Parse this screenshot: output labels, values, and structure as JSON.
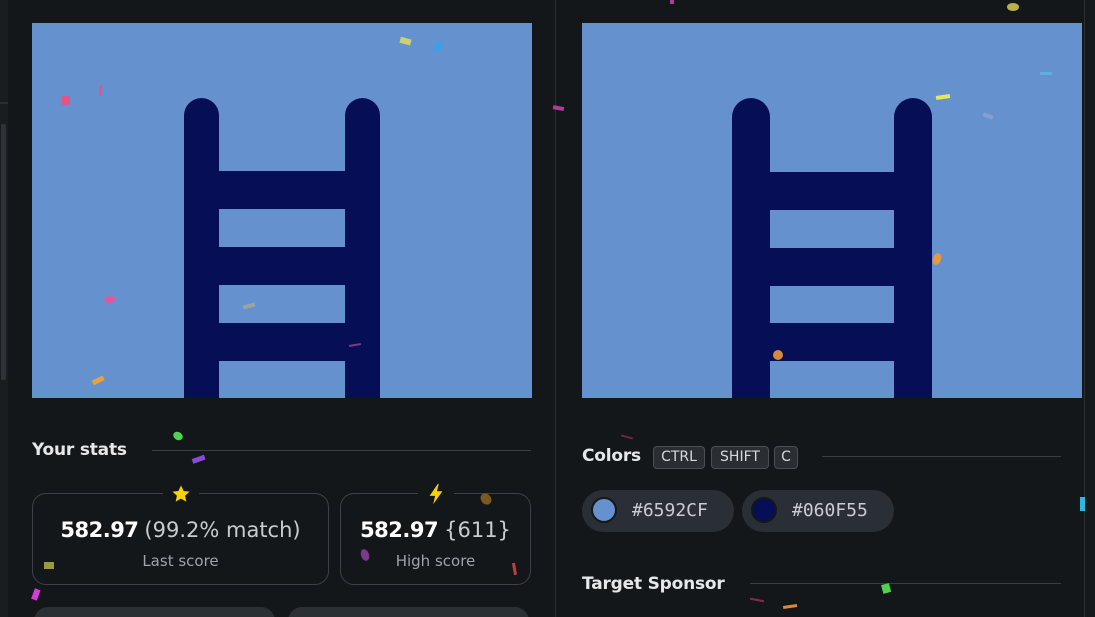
{
  "colors": {
    "background": "#14171a",
    "canvas_bg": "#6592CF",
    "ladder": "#060F55",
    "star": "#f5d300",
    "bolt": "#f5d300"
  },
  "stats": {
    "title": "Your stats",
    "last": {
      "icon": "star-icon",
      "value": "582.97",
      "extra": "(99.2% match)",
      "caption": "Last score"
    },
    "high": {
      "icon": "lightning-icon",
      "value": "582.97",
      "extra": "{611}",
      "caption": "High score"
    }
  },
  "colors_section": {
    "title": "Colors",
    "shortcut_keys": [
      "CTRL",
      "SHIFT",
      "C"
    ],
    "swatches": [
      {
        "hex": "#6592CF",
        "color": "#6592CF"
      },
      {
        "hex": "#060F55",
        "color": "#060F55"
      }
    ]
  },
  "sponsor": {
    "title": "Target Sponsor"
  }
}
